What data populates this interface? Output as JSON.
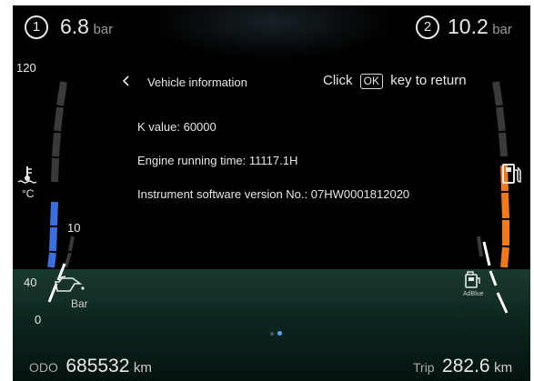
{
  "top": {
    "left_circuit": "1",
    "left_pressure": "6.8",
    "left_unit": "bar",
    "right_circuit": "2",
    "right_pressure": "10.2",
    "right_unit": "bar"
  },
  "left_gauge": {
    "max_label": "120",
    "mid_label": "10",
    "low_label": "40",
    "zero_label": "0",
    "temp_unit": "°C",
    "oil_unit": "Bar",
    "coolant_icon": "coolant-temperature-icon",
    "oil_icon": "oil-pressure-icon",
    "coolant_fill_color": "#3a6fe0"
  },
  "right_gauge": {
    "fuel_icon": "fuel-pump-icon",
    "adblue_icon": "adblue-icon",
    "adblue_label": "AdBlue",
    "fuel_fill_color": "#f07a1a"
  },
  "menu": {
    "back_icon": "chevron-left-icon",
    "title": "Vehicle information",
    "hint_prefix": "Click",
    "hint_key": "OK",
    "hint_suffix": "key to return",
    "lines": [
      "K value: 60000",
      "Engine running time: 11117.1H",
      "Instrument software version No.: 07HW0001812020"
    ]
  },
  "bottom": {
    "odo_label": "ODO",
    "odo_value": "685532",
    "odo_unit": "km",
    "trip_label": "Trip",
    "trip_value": "282.6",
    "trip_unit": "km"
  }
}
